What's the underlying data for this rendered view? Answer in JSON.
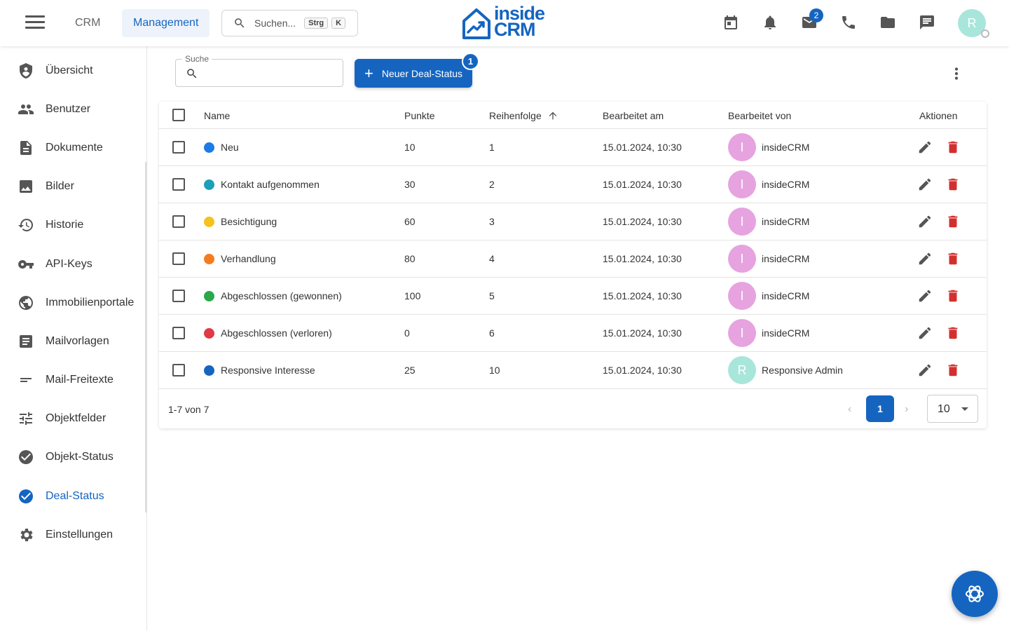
{
  "header": {
    "tabs": [
      {
        "label": "CRM",
        "active": false
      },
      {
        "label": "Management",
        "active": true
      }
    ],
    "search": {
      "placeholder": "Suchen...",
      "kbd1": "Strg",
      "kbd2": "K"
    },
    "logo_line1": "inside",
    "logo_line2": "CRM",
    "mail_badge": "2",
    "user_initial": "R",
    "icons": [
      "calendar-icon",
      "bell-icon",
      "mail-icon",
      "phone-icon",
      "folder-icon",
      "chat-icon"
    ]
  },
  "sidebar": {
    "items": [
      {
        "label": "Übersicht",
        "icon": "shield-user-icon"
      },
      {
        "label": "Benutzer",
        "icon": "people-icon"
      },
      {
        "label": "Dokumente",
        "icon": "document-icon"
      },
      {
        "label": "Bilder",
        "icon": "image-icon"
      },
      {
        "label": "Historie",
        "icon": "history-icon"
      },
      {
        "label": "API-Keys",
        "icon": "key-icon"
      },
      {
        "label": "Immobilienportale",
        "icon": "globe-icon"
      },
      {
        "label": "Mailvorlagen",
        "icon": "template-icon"
      },
      {
        "label": "Mail-Freitexte",
        "icon": "short-text-icon"
      },
      {
        "label": "Objektfelder",
        "icon": "tune-icon"
      },
      {
        "label": "Objekt-Status",
        "icon": "check-circle-icon"
      },
      {
        "label": "Deal-Status",
        "icon": "check-circle-icon",
        "active": true
      },
      {
        "label": "Einstellungen",
        "icon": "gear-icon"
      }
    ]
  },
  "toolbar": {
    "search_label": "Suche",
    "new_button": "Neuer Deal-Status",
    "new_badge": "1"
  },
  "table": {
    "columns": [
      "Name",
      "Punkte",
      "Reihenfolge",
      "Bearbeitet am",
      "Bearbeitet von",
      "Aktionen"
    ],
    "sort_column": "Reihenfolge",
    "sort_direction": "asc",
    "rows": [
      {
        "name": "Neu",
        "color": "#1e7be6",
        "points": "10",
        "order": "1",
        "edited_at": "15.01.2024, 10:30",
        "editor": "insideCRM",
        "editor_initial": "I",
        "avatar_color": "#e6a3e0"
      },
      {
        "name": "Kontakt aufgenommen",
        "color": "#1ba0b8",
        "points": "30",
        "order": "2",
        "edited_at": "15.01.2024, 10:30",
        "editor": "insideCRM",
        "editor_initial": "I",
        "avatar_color": "#e6a3e0"
      },
      {
        "name": "Besichtigung",
        "color": "#f6c21b",
        "points": "60",
        "order": "3",
        "edited_at": "15.01.2024, 10:30",
        "editor": "insideCRM",
        "editor_initial": "I",
        "avatar_color": "#e6a3e0"
      },
      {
        "name": "Verhandlung",
        "color": "#f47c20",
        "points": "80",
        "order": "4",
        "edited_at": "15.01.2024, 10:30",
        "editor": "insideCRM",
        "editor_initial": "I",
        "avatar_color": "#e6a3e0"
      },
      {
        "name": "Abgeschlossen (gewonnen)",
        "color": "#2aa84a",
        "points": "100",
        "order": "5",
        "edited_at": "15.01.2024, 10:30",
        "editor": "insideCRM",
        "editor_initial": "I",
        "avatar_color": "#e6a3e0"
      },
      {
        "name": "Abgeschlossen (verloren)",
        "color": "#e03a45",
        "points": "0",
        "order": "6",
        "edited_at": "15.01.2024, 10:30",
        "editor": "insideCRM",
        "editor_initial": "I",
        "avatar_color": "#e6a3e0"
      },
      {
        "name": "Responsive Interesse",
        "color": "#1565c0",
        "points": "25",
        "order": "10",
        "edited_at": "15.01.2024, 10:30",
        "editor": "Responsive Admin",
        "editor_initial": "R",
        "avatar_color": "#a8e6dc"
      }
    ]
  },
  "pagination": {
    "range": "1-7 von 7",
    "current_page": "1",
    "page_size": "10"
  },
  "colors": {
    "accent": "#1565c0",
    "delete": "#d32f2f",
    "edit": "#555555"
  }
}
